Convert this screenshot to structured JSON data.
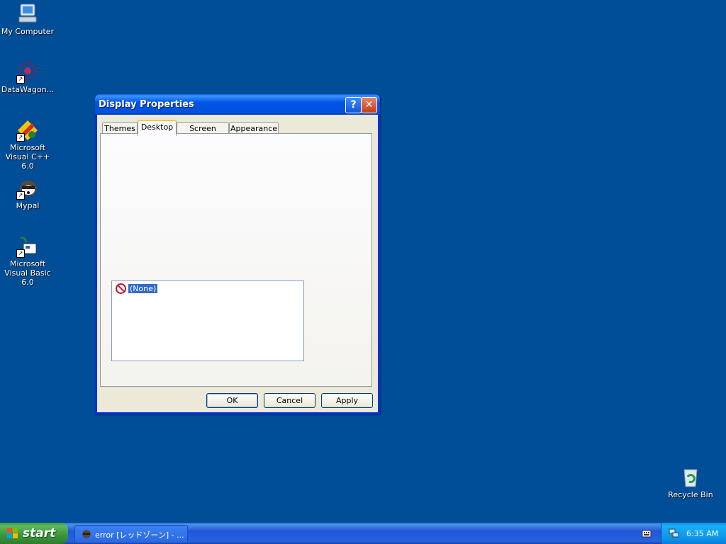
{
  "desktop": {
    "icons": [
      {
        "label": "My Computer",
        "icon": "my-computer-icon"
      },
      {
        "label": "DataWagon...",
        "icon": "datawagon-icon"
      },
      {
        "label": "Microsoft Visual C++ 6.0",
        "icon": "visual-cpp-icon"
      },
      {
        "label": "Mypal",
        "icon": "mypal-icon"
      },
      {
        "label": "Microsoft Visual Basic 6.0",
        "icon": "visual-basic-icon"
      },
      {
        "label": "Recycle Bin",
        "icon": "recycle-bin-icon"
      }
    ]
  },
  "dialog": {
    "title": "Display Properties",
    "tabs": [
      "Themes",
      "Desktop",
      "Screen Saver",
      "Appearance"
    ],
    "active_tab": "Desktop",
    "list": {
      "selected_item": "(None)"
    },
    "buttons": {
      "ok": "OK",
      "cancel": "Cancel",
      "apply": "Apply"
    }
  },
  "taskbar": {
    "start_label": "start",
    "task_label": "error [レッドゾーン] - ...",
    "clock": "6:35 AM"
  },
  "colors": {
    "desktop": "#004e98",
    "title_bar": "#0055e5",
    "start_green": "#3a953a",
    "selection": "#316ac5"
  }
}
